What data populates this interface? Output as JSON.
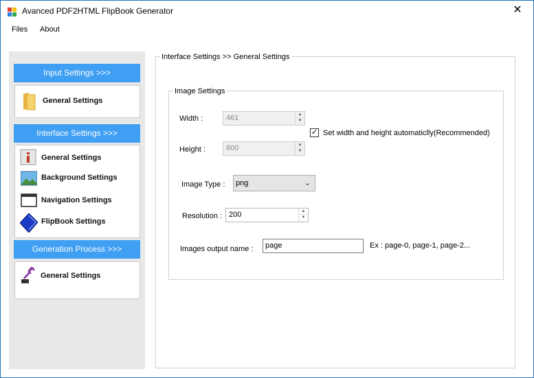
{
  "window": {
    "title": "Avanced PDF2HTML FlipBook Generator",
    "close_glyph": "✕"
  },
  "menu": {
    "files": "Files",
    "about": "About"
  },
  "sidebar": {
    "input_header": "Input Settings >>>",
    "input_items": [
      {
        "label": "General Settings",
        "icon": "folder-icon"
      }
    ],
    "interface_header": "Interface Settings >>>",
    "interface_items": [
      {
        "label": "General Settings",
        "icon": "info-icon"
      },
      {
        "label": "Background Settings",
        "icon": "landscape-image-icon"
      },
      {
        "label": "Navigation Settings",
        "icon": "window-icon"
      },
      {
        "label": "FlipBook Settings",
        "icon": "book-icon"
      }
    ],
    "generation_header": "Generation Process >>>",
    "generation_items": [
      {
        "label": "General Settings",
        "icon": "wrench-icon"
      }
    ]
  },
  "content": {
    "breadcrumb": "Interface Settings >> General Settings",
    "image_settings": {
      "group_title": "Image Settings",
      "width_label": "Width :",
      "width_value": "461",
      "height_label": "Height :",
      "height_value": "600",
      "auto_size_label": "Set width and height automaticlly(Recommended)",
      "auto_size_checked": true,
      "check_glyph": "✓",
      "image_type_label": "Image Type :",
      "image_type_value": "png",
      "resolution_label": "Resolution :",
      "resolution_value": "200",
      "output_name_label": "Images output name :",
      "output_name_value": "page",
      "output_name_example": "Ex : page-0, page-1, page-2..."
    }
  },
  "colors": {
    "section_header_bg": "#3f9ff3",
    "sidebar_bg": "#e8e8e8",
    "window_border": "#1e73be"
  }
}
